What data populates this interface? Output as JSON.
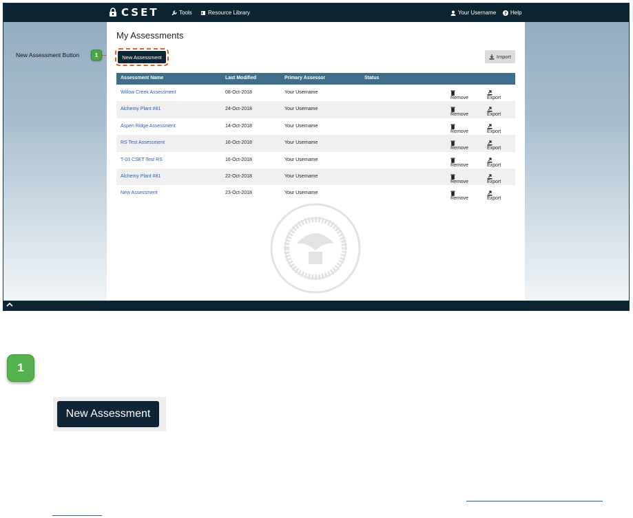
{
  "app": {
    "logo_text": "CSET",
    "nav": {
      "tools": "Tools",
      "resource_library": "Resource Library",
      "user": "Your Username",
      "help": "Help"
    }
  },
  "page": {
    "title": "My Assessments",
    "new_button": "New Assessment",
    "import_button": "Import"
  },
  "table": {
    "headers": [
      "Assessment Name",
      "Last Modified",
      "Primary Assessor",
      "Status"
    ],
    "remove_label": "Remove",
    "export_label": "Export",
    "rows": [
      {
        "name": "Willow Creek Assessment",
        "modified": "08-Oct-2018",
        "assessor": "Your Username"
      },
      {
        "name": "Alchemy Plant #81",
        "modified": "24-Oct-2018",
        "assessor": "Your Username"
      },
      {
        "name": "Aspen Ridge Assessment",
        "modified": "14-Oct-2018",
        "assessor": "Your Username"
      },
      {
        "name": "RS Test Assessment",
        "modified": "16-Oct-2018",
        "assessor": "Your Username"
      },
      {
        "name": "T-03 CSET Test RS",
        "modified": "16-Oct-2018",
        "assessor": "Your Username"
      },
      {
        "name": "Alchemy Plant #81",
        "modified": "22-Oct-2018",
        "assessor": "Your Username"
      },
      {
        "name": "New Assessment",
        "modified": "23-Oct-2018",
        "assessor": "Your Username"
      }
    ]
  },
  "callout": {
    "label": "New Assessment Button",
    "number": "1"
  },
  "detail": {
    "number": "1",
    "button_label": "New Assessment"
  },
  "colors": {
    "navy": "#0c2432",
    "header_blue": "#3f6e8a",
    "callout_orange": "#e0601a",
    "badge_green": "#54b34f",
    "link_blue": "#2a5cbf"
  },
  "icons": {
    "lock": "lock-icon",
    "wrench": "wrench-icon",
    "book": "book-icon",
    "user": "user-icon",
    "help": "help-icon",
    "trash": "trash-icon",
    "export": "export-icon",
    "import": "import-icon",
    "chevron": "chevron-up-icon",
    "seal": "dhs-seal-icon"
  }
}
